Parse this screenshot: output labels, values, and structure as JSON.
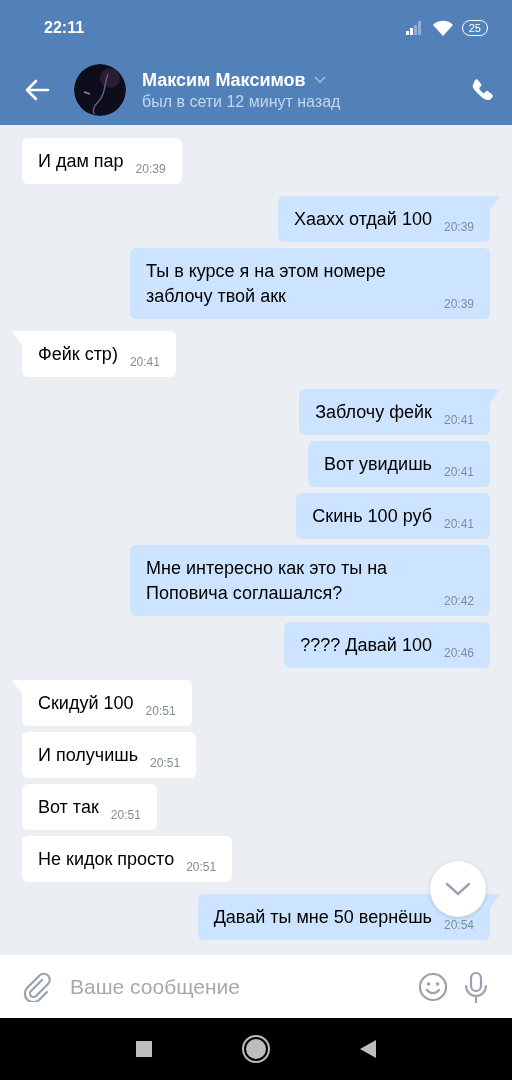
{
  "status_bar": {
    "time": "22:11",
    "battery": "25"
  },
  "header": {
    "name": "Максим Максимов",
    "status": "был в сети 12 минут назад"
  },
  "messages": [
    {
      "outgoing": false,
      "tail": false,
      "text": "И дам пар",
      "time": "20:39"
    },
    {
      "outgoing": true,
      "tail": true,
      "text": "Хааxx отдай 100",
      "time": "20:39"
    },
    {
      "outgoing": true,
      "tail": false,
      "text": "Ты в курсе я на этом номере заблочу твой акк",
      "time": "20:39"
    },
    {
      "outgoing": false,
      "tail": true,
      "text": "Фейк стр)",
      "time": "20:41"
    },
    {
      "outgoing": true,
      "tail": true,
      "text": "Заблочу фейк",
      "time": "20:41"
    },
    {
      "outgoing": true,
      "tail": false,
      "text": "Вот увидишь",
      "time": "20:41"
    },
    {
      "outgoing": true,
      "tail": false,
      "text": "Скинь 100 руб",
      "time": "20:41"
    },
    {
      "outgoing": true,
      "tail": false,
      "text": "Мне интересно как это ты на Поповича соглашался?",
      "time": "20:42"
    },
    {
      "outgoing": true,
      "tail": false,
      "text": "???? Давай 100",
      "time": "20:46"
    },
    {
      "outgoing": false,
      "tail": true,
      "text": "Скидуй 100",
      "time": "20:51"
    },
    {
      "outgoing": false,
      "tail": false,
      "text": "И получишь",
      "time": "20:51"
    },
    {
      "outgoing": false,
      "tail": false,
      "text": "Вот так",
      "time": "20:51"
    },
    {
      "outgoing": false,
      "tail": false,
      "text": "Не кидок просто",
      "time": "20:51"
    },
    {
      "outgoing": true,
      "tail": true,
      "text": "Давай ты мне 50 вернёшь",
      "time": "20:54"
    }
  ],
  "composer": {
    "placeholder": "Ваше сообщение"
  }
}
